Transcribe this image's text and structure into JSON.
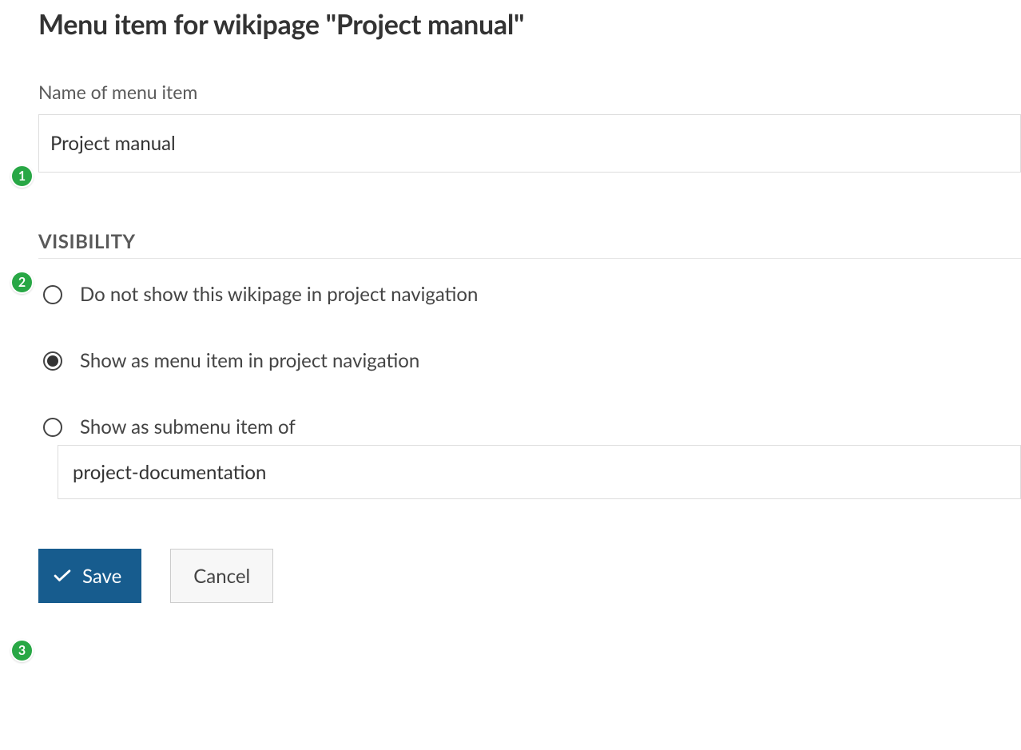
{
  "title": "Menu item for wikipage \"Project manual\"",
  "name_field": {
    "label": "Name of menu item",
    "value": "Project manual"
  },
  "visibility": {
    "heading": "VISIBILITY",
    "options": {
      "none": "Do not show this wikipage in project navigation",
      "main": "Show as menu item in project navigation",
      "sub": "Show as submenu item of"
    },
    "submenu_value": "project-documentation",
    "selected": "main"
  },
  "buttons": {
    "save": "Save",
    "cancel": "Cancel"
  },
  "badges": {
    "b1": "1",
    "b2": "2",
    "b3": "3"
  }
}
